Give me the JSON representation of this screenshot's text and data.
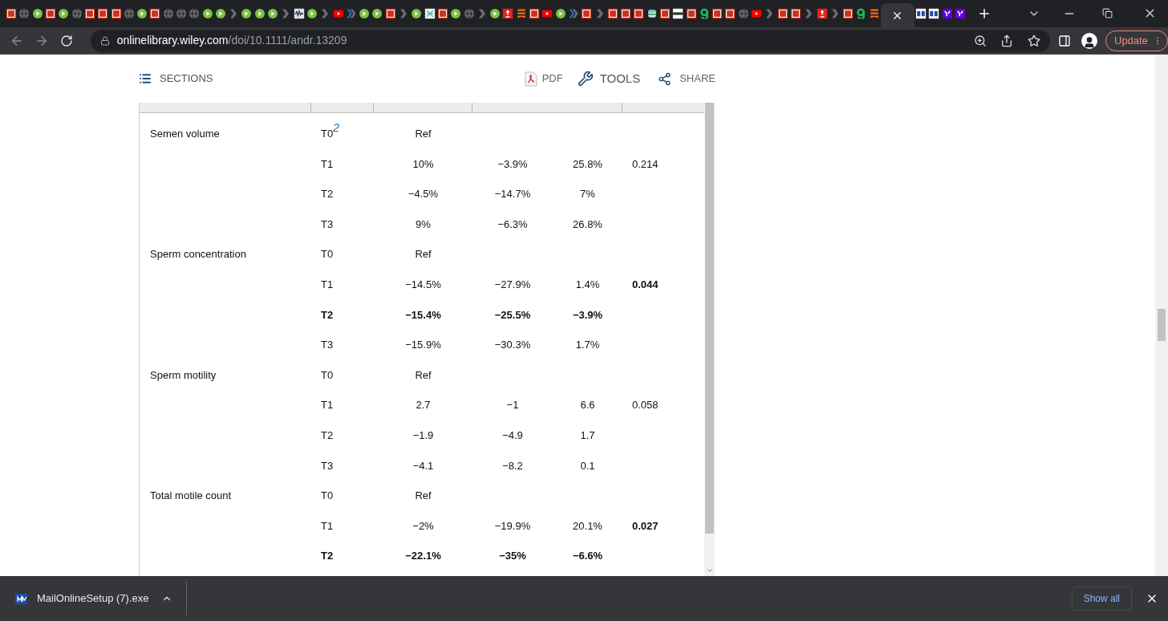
{
  "browser": {
    "tabs": [
      {
        "kind": "emblem",
        "selected": false
      },
      {
        "kind": "globe",
        "selected": false
      },
      {
        "kind": "play",
        "selected": false
      },
      {
        "kind": "emblem",
        "selected": false
      },
      {
        "kind": "play",
        "selected": false
      },
      {
        "kind": "globe",
        "selected": false
      },
      {
        "kind": "emblem",
        "selected": false
      },
      {
        "kind": "emblem",
        "selected": false
      },
      {
        "kind": "emblem",
        "selected": false
      },
      {
        "kind": "globe",
        "selected": false
      },
      {
        "kind": "play",
        "selected": false
      },
      {
        "kind": "emblem",
        "selected": false
      },
      {
        "kind": "globe",
        "selected": false
      },
      {
        "kind": "globe",
        "selected": false
      },
      {
        "kind": "globe",
        "selected": false
      },
      {
        "kind": "play",
        "selected": false
      },
      {
        "kind": "play",
        "selected": false
      },
      {
        "kind": "chevron",
        "selected": false
      },
      {
        "kind": "play",
        "selected": false
      },
      {
        "kind": "play",
        "selected": false
      },
      {
        "kind": "play",
        "selected": false
      },
      {
        "kind": "chevron",
        "selected": false
      },
      {
        "kind": "wave",
        "selected": false
      },
      {
        "kind": "play",
        "selected": false
      },
      {
        "kind": "chevron",
        "selected": false
      },
      {
        "kind": "video",
        "selected": false
      },
      {
        "kind": "chevron-blue",
        "selected": false
      },
      {
        "kind": "play",
        "selected": false
      },
      {
        "kind": "play",
        "selected": false
      },
      {
        "kind": "emblem",
        "selected": false
      },
      {
        "kind": "chevron",
        "selected": false
      },
      {
        "kind": "play",
        "selected": false
      },
      {
        "kind": "doc",
        "selected": false
      },
      {
        "kind": "emblem",
        "selected": false
      },
      {
        "kind": "play",
        "selected": false
      },
      {
        "kind": "globe",
        "selected": false
      },
      {
        "kind": "chevron",
        "selected": false
      },
      {
        "kind": "play",
        "selected": false
      },
      {
        "kind": "alert",
        "selected": false
      },
      {
        "kind": "bookmark",
        "selected": false
      },
      {
        "kind": "emblem",
        "selected": false
      },
      {
        "kind": "video",
        "selected": false
      },
      {
        "kind": "play",
        "selected": false
      },
      {
        "kind": "chevron-blue",
        "selected": false
      },
      {
        "kind": "emblem",
        "selected": false
      },
      {
        "kind": "chevron",
        "selected": false
      },
      {
        "kind": "emblem",
        "selected": false
      },
      {
        "kind": "emblem",
        "selected": false
      },
      {
        "kind": "emblem",
        "selected": false
      },
      {
        "kind": "cylinder",
        "selected": false
      },
      {
        "kind": "emblem",
        "selected": false
      },
      {
        "kind": "bar",
        "selected": false
      },
      {
        "kind": "emblem",
        "selected": false
      },
      {
        "kind": "hook",
        "selected": false
      },
      {
        "kind": "emblem",
        "selected": false
      },
      {
        "kind": "emblem",
        "selected": false
      },
      {
        "kind": "globe",
        "selected": false
      },
      {
        "kind": "video",
        "selected": false
      },
      {
        "kind": "chevron",
        "selected": false
      },
      {
        "kind": "emblem",
        "selected": false
      },
      {
        "kind": "emblem",
        "selected": false
      },
      {
        "kind": "chevron",
        "selected": false
      },
      {
        "kind": "alert",
        "selected": false
      },
      {
        "kind": "chevron",
        "selected": false
      },
      {
        "kind": "emblem",
        "selected": false
      },
      {
        "kind": "hook",
        "selected": false
      },
      {
        "kind": "bookmark",
        "selected": false
      },
      {
        "kind": "blank",
        "selected": true
      },
      {
        "kind": "blocks",
        "selected": false
      },
      {
        "kind": "blocks",
        "selected": false
      },
      {
        "kind": "purple",
        "selected": false
      },
      {
        "kind": "purple",
        "selected": false
      }
    ],
    "address": {
      "host": "onlinelibrary.wiley.com",
      "path": "/doi/10.1111/andr.13209"
    },
    "update_button": "Update"
  },
  "article_toolbar": {
    "sections": "SECTIONS",
    "pdf": "PDF",
    "tools": "TOOLS",
    "share": "SHARE"
  },
  "table": {
    "rows": [
      {
        "outcome": "Semen volume",
        "time": "T0$^{2}$",
        "estimate": "Ref",
        "bold": false
      },
      {
        "time": "T1",
        "estimate": "10%",
        "lower": "−3.9%",
        "upper": "25.8%",
        "p": "0.214",
        "p_bold": false,
        "bold": false
      },
      {
        "time": "T2",
        "estimate": "−4.5%",
        "lower": "−14.7%",
        "upper": "7%",
        "bold": false
      },
      {
        "time": "T3",
        "estimate": "9%",
        "lower": "−6.3%",
        "upper": "26.8%",
        "bold": false
      },
      {
        "outcome": "Sperm concentration",
        "time": "T0",
        "estimate": "Ref",
        "bold": false
      },
      {
        "time": "T1",
        "estimate": "−14.5%",
        "lower": "−27.9%",
        "upper": "1.4%",
        "p": "0.044",
        "p_bold": true,
        "bold": false
      },
      {
        "time": "T2",
        "estimate": "−15.4%",
        "lower": "−25.5%",
        "upper": "−3.9%",
        "bold": true
      },
      {
        "time": "T3",
        "estimate": "−15.9%",
        "lower": "−30.3%",
        "upper": "1.7%",
        "bold": false
      },
      {
        "outcome": "Sperm motility",
        "time": "T0",
        "estimate": "Ref",
        "bold": false
      },
      {
        "time": "T1",
        "estimate": "2.7",
        "lower": "−1",
        "upper": "6.6",
        "p": "0.058",
        "p_bold": false,
        "bold": false
      },
      {
        "time": "T2",
        "estimate": "−1.9",
        "lower": "−4.9",
        "upper": "1.7",
        "bold": false
      },
      {
        "time": "T3",
        "estimate": "−4.1",
        "lower": "−8.2",
        "upper": "0.1",
        "bold": false
      },
      {
        "outcome": "Total motile count",
        "time": "T0",
        "estimate": "Ref",
        "bold": false
      },
      {
        "time": "T1",
        "estimate": "−2%",
        "lower": "−19.9%",
        "upper": "20.1%",
        "p": "0.027",
        "p_bold": true,
        "bold": false
      },
      {
        "time": "T2",
        "estimate": "−22.1%",
        "lower": "−35%",
        "upper": "−6.6%",
        "bold": true
      }
    ]
  },
  "download_bar": {
    "file": "MailOnlineSetup (7).exe",
    "show_all": "Show all"
  }
}
